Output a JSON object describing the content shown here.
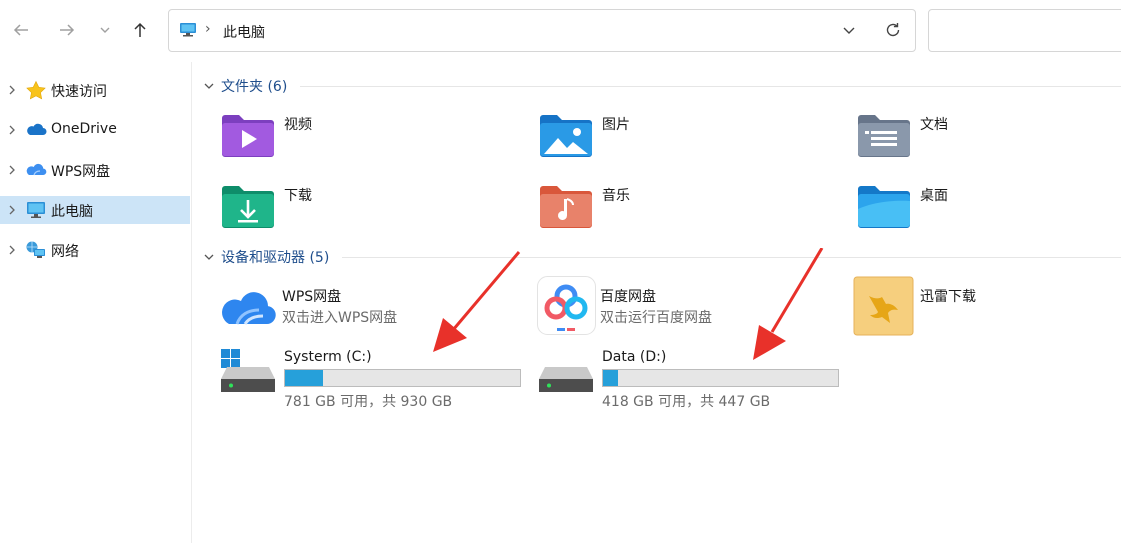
{
  "address": {
    "location": "此电脑"
  },
  "sidebar": {
    "items": [
      {
        "label": "快速访问",
        "icon": "star-icon"
      },
      {
        "label": "OneDrive",
        "icon": "onedrive-cloud-icon"
      },
      {
        "label": "WPS网盘",
        "icon": "wps-cloud-icon"
      },
      {
        "label": "此电脑",
        "icon": "this-pc-icon",
        "selected": true
      },
      {
        "label": "网络",
        "icon": "network-icon"
      }
    ]
  },
  "folders_section": {
    "title": "文件夹 (6)"
  },
  "folders": [
    {
      "name": "视频",
      "icon": "videos-folder-icon"
    },
    {
      "name": "图片",
      "icon": "pictures-folder-icon"
    },
    {
      "name": "文档",
      "icon": "documents-folder-icon"
    },
    {
      "name": "下载",
      "icon": "downloads-folder-icon"
    },
    {
      "name": "音乐",
      "icon": "music-folder-icon"
    },
    {
      "name": "桌面",
      "icon": "desktop-folder-icon"
    }
  ],
  "devices_section": {
    "title": "设备和驱动器 (5)"
  },
  "devices": {
    "wps": {
      "name": "WPS网盘",
      "subtitle": "双击进入WPS网盘"
    },
    "baidu": {
      "name": "百度网盘",
      "subtitle": "双击运行百度网盘"
    },
    "xunlei": {
      "name": "迅雷下载"
    },
    "drive_c": {
      "name": "Systerm (C:)",
      "free_text": "781 GB 可用，共 930 GB",
      "used_fraction": 0.16
    },
    "drive_d": {
      "name": "Data (D:)",
      "free_text": "418 GB 可用，共 447 GB",
      "used_fraction": 0.065
    }
  },
  "colors": {
    "accent": "#26a0da",
    "selection": "#cce4f7",
    "section_title": "#1f4e8c",
    "annotation_arrow": "#e8312a"
  }
}
